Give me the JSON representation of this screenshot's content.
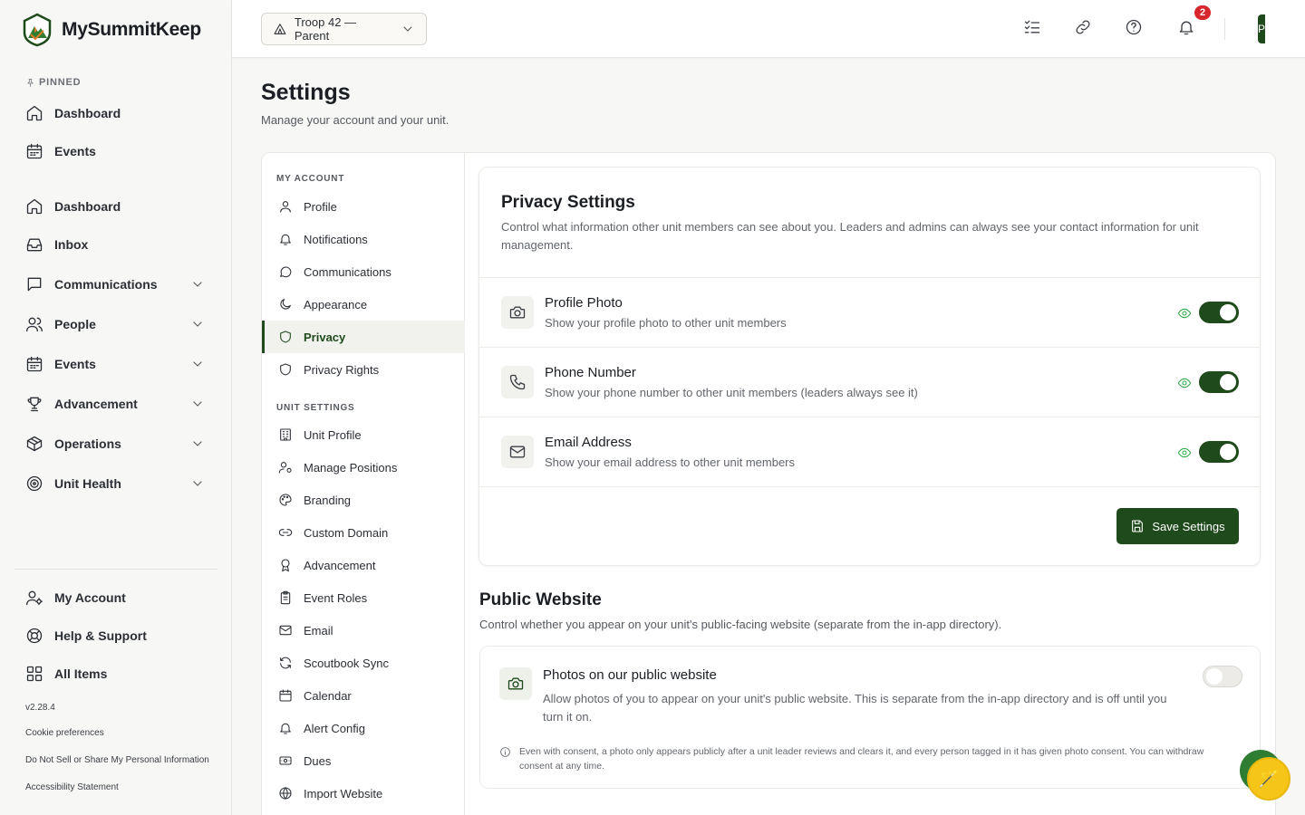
{
  "brand": {
    "name": "MySummitKeep"
  },
  "sidebar": {
    "pinned_label": "PINNED",
    "pinned": [
      {
        "label": "Dashboard",
        "icon": "home-icon"
      },
      {
        "label": "Events",
        "icon": "calendar-icon"
      }
    ],
    "items": [
      {
        "label": "Dashboard",
        "icon": "home-icon"
      },
      {
        "label": "Inbox",
        "icon": "inbox-icon"
      },
      {
        "label": "Communications",
        "icon": "message-icon",
        "expandable": true
      },
      {
        "label": "People",
        "icon": "users-icon",
        "expandable": true
      },
      {
        "label": "Events",
        "icon": "calendar-icon",
        "expandable": true
      },
      {
        "label": "Advancement",
        "icon": "trophy-icon",
        "expandable": true
      },
      {
        "label": "Operations",
        "icon": "box-icon",
        "expandable": true
      },
      {
        "label": "Unit Health",
        "icon": "target-icon",
        "expandable": true
      }
    ],
    "bottom": [
      {
        "label": "My Account",
        "icon": "user-cog-icon"
      },
      {
        "label": "Help & Support",
        "icon": "lifebuoy-icon"
      },
      {
        "label": "All Items",
        "icon": "grid-icon"
      }
    ],
    "version": "v2.28.4",
    "cookie": "Cookie preferences",
    "do_not_sell": "Do Not Sell or Share My Personal Information",
    "accessibility": "Accessibility Statement"
  },
  "topbar": {
    "unit_switch": "Troop 42 — Parent",
    "notification_count": "2",
    "avatar_initial": "P"
  },
  "page": {
    "title": "Settings",
    "subtitle": "Manage your account and your unit."
  },
  "settings_nav": {
    "my_account_label": "MY ACCOUNT",
    "my_account": [
      {
        "label": "Profile",
        "icon": "user-icon"
      },
      {
        "label": "Notifications",
        "icon": "bell-icon"
      },
      {
        "label": "Communications",
        "icon": "message-circle-icon"
      },
      {
        "label": "Appearance",
        "icon": "moon-icon"
      },
      {
        "label": "Privacy",
        "icon": "shield-icon",
        "active": true
      },
      {
        "label": "Privacy Rights",
        "icon": "shield-icon"
      }
    ],
    "unit_settings_label": "UNIT SETTINGS",
    "unit_settings": [
      {
        "label": "Unit Profile",
        "icon": "building-icon"
      },
      {
        "label": "Manage Positions",
        "icon": "user-cog-icon"
      },
      {
        "label": "Branding",
        "icon": "palette-icon"
      },
      {
        "label": "Custom Domain",
        "icon": "link-icon"
      },
      {
        "label": "Advancement",
        "icon": "award-icon"
      },
      {
        "label": "Event Roles",
        "icon": "clipboard-icon"
      },
      {
        "label": "Email",
        "icon": "mail-icon"
      },
      {
        "label": "Scoutbook Sync",
        "icon": "refresh-icon"
      },
      {
        "label": "Calendar",
        "icon": "calendar-icon"
      },
      {
        "label": "Alert Config",
        "icon": "bell-icon"
      },
      {
        "label": "Dues",
        "icon": "money-icon"
      },
      {
        "label": "Import Website",
        "icon": "globe-icon"
      }
    ]
  },
  "privacy": {
    "title": "Privacy Settings",
    "description": "Control what information other unit members can see about you. Leaders and admins can always see your contact information for unit management.",
    "rows": [
      {
        "title": "Profile Photo",
        "desc": "Show your profile photo to other unit members",
        "icon": "camera-icon",
        "enabled": true
      },
      {
        "title": "Phone Number",
        "desc": "Show your phone number to other unit members (leaders always see it)",
        "icon": "phone-icon",
        "enabled": true
      },
      {
        "title": "Email Address",
        "desc": "Show your email address to other unit members",
        "icon": "mail-icon",
        "enabled": true
      }
    ],
    "save_label": "Save Settings"
  },
  "public_website": {
    "title": "Public Website",
    "description": "Control whether you appear on your unit's public-facing website (separate from the in-app directory).",
    "row_title": "Photos on our public website",
    "row_desc": "Allow photos of you to appear on your unit's public website. This is separate from the in-app directory and is off until you turn it on.",
    "enabled": false,
    "note": "Even with consent, a photo only appears publicly after a unit leader reviews and clears it, and every person tagged in it has given photo consent. You can withdraw consent at any time."
  },
  "colors": {
    "accent": "#1f4a1b",
    "eye": "#2ea84a",
    "badge": "#d7262c"
  }
}
